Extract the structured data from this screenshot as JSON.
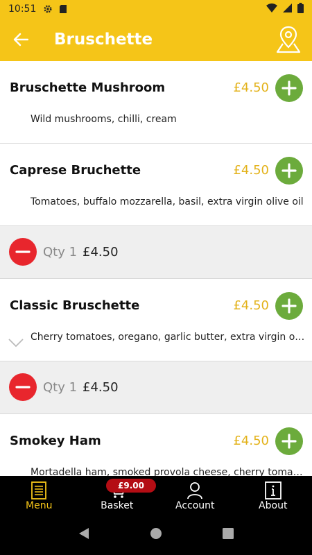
{
  "status_bar": {
    "time": "10:51"
  },
  "app_bar": {
    "title": "Bruschette"
  },
  "items": [
    {
      "name": "Bruschette Mushroom",
      "price": "£4.50",
      "description": "Wild mushrooms, chilli, cream"
    },
    {
      "name": "Caprese Bruchette",
      "price": "£4.50",
      "description": "Tomatoes, buffalo mozzarella, basil, extra virgin olive oil"
    },
    {
      "name": "Classic Bruschette",
      "price": "£4.50",
      "description": "Cherry tomatoes, oregano, garlic butter, extra virgin olive oil"
    },
    {
      "name": "Smokey Ham",
      "price": "£4.50",
      "description": "Mortadella ham, smoked provola cheese, cherry tomatoes"
    }
  ],
  "qty_rows": [
    {
      "qty": "Qty 1",
      "price": "£4.50"
    },
    {
      "qty": "Qty 1",
      "price": "£4.50"
    }
  ],
  "bottom_nav": {
    "menu": "Menu",
    "basket": "Basket",
    "account": "Account",
    "about": "About",
    "basket_badge": "£9.00"
  },
  "colors": {
    "accent": "#f5c518",
    "add": "#6cab3c",
    "remove": "#e8262d",
    "badge": "#b40d14"
  }
}
